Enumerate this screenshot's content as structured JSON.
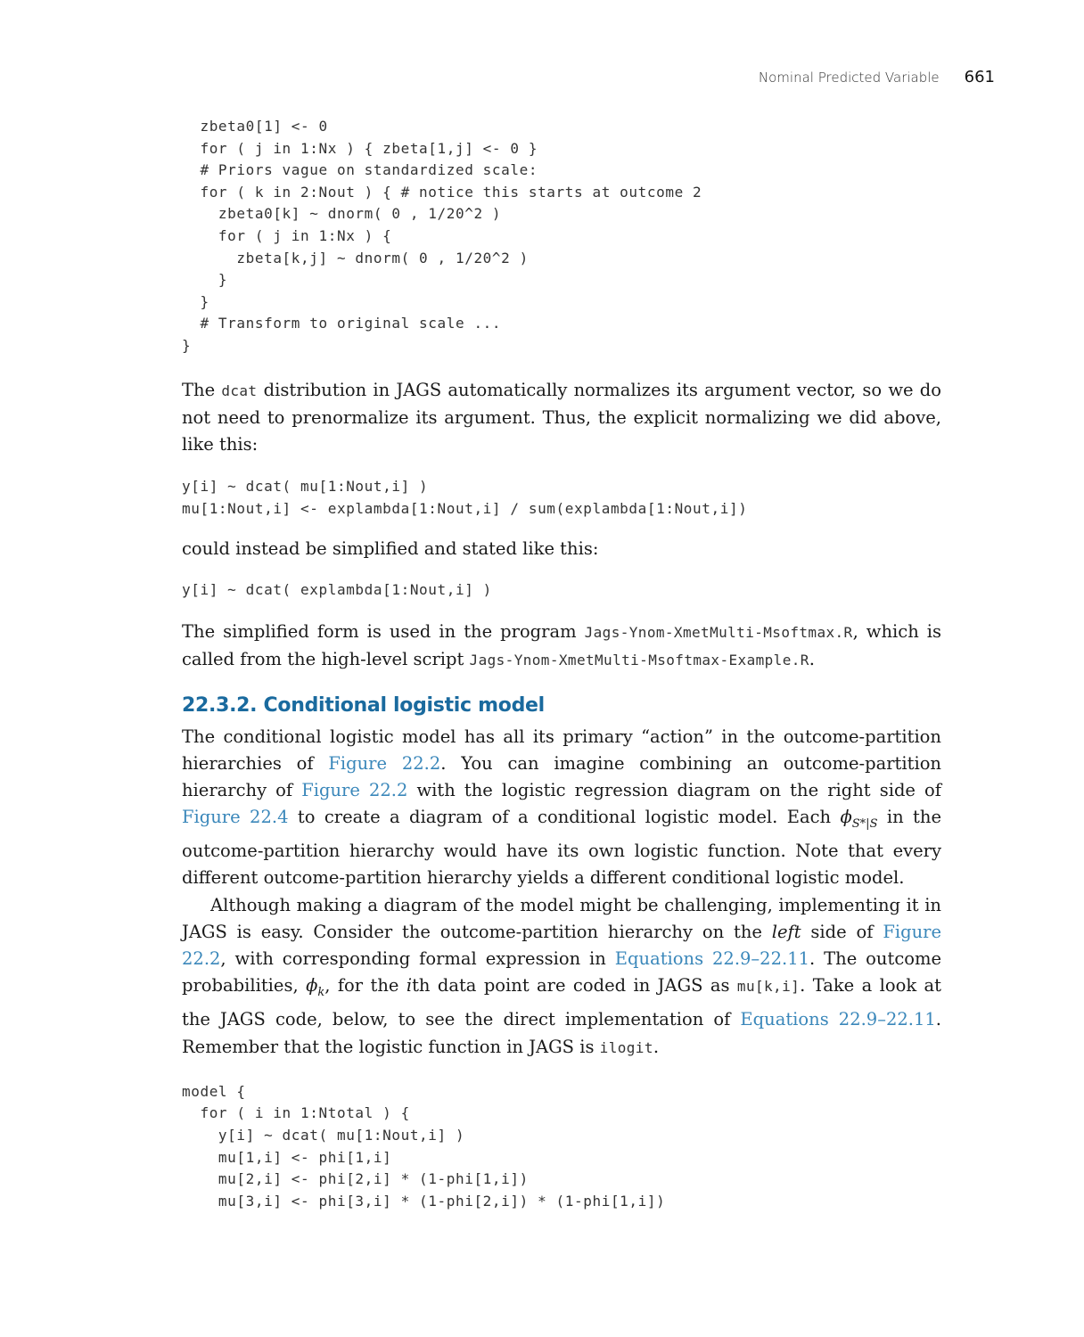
{
  "header": {
    "running_title": "Nominal Predicted Variable",
    "page_number": "661"
  },
  "code_block_1": [
    "  zbeta0[1] <- 0",
    "  for ( j in 1:Nx ) { zbeta[1,j] <- 0 }",
    "  # Priors vague on standardized scale:",
    "  for ( k in 2:Nout ) { # notice this starts at outcome 2",
    "    zbeta0[k] ~ dnorm( 0 , 1/20^2 )",
    "    for ( j in 1:Nx ) {",
    "      zbeta[k,j] ~ dnorm( 0 , 1/20^2 )",
    "    }",
    "  }",
    "  # Transform to original scale ...",
    "}"
  ],
  "para_1": {
    "t1": "The ",
    "code1": "dcat",
    "t2": " distribution in JAGS automatically normalizes its argument vector, so we do not need to prenormalize its argument. Thus, the explicit normalizing we did above, like this:"
  },
  "code_block_2": [
    "y[i] ~ dcat( mu[1:Nout,i] )",
    "mu[1:Nout,i] <- explambda[1:Nout,i] / sum(explambda[1:Nout,i])"
  ],
  "para_2": "could instead be simplified and stated like this:",
  "code_block_3": [
    "y[i] ~ dcat( explambda[1:Nout,i] )"
  ],
  "para_3": {
    "t1": "The simplified form is used in the program ",
    "code1": "Jags-Ynom-XmetMulti-Msoftmax.R",
    "t2": ", which is called from the high-level script ",
    "code2": "Jags-Ynom-XmetMulti-Msoftmax-Example.R",
    "t3": "."
  },
  "section": {
    "heading": "22.3.2.  Conditional logistic model"
  },
  "para_4": {
    "t1": "The conditional logistic model has all its primary “action” in the outcome-partition hierarchies of ",
    "link1": "Figure 22.2",
    "t2": ". You can imagine combining an outcome-partition hierarchy of ",
    "link2": "Figure 22.2",
    "t3": " with the logistic regression diagram on the right side of ",
    "link3": "Figure 22.4",
    "t4": " to create a diagram of a conditional logistic model. Each ",
    "math_phi": "ϕ",
    "math_sub": "S*|S",
    "t5": " in the outcome-partition hierarchy would have its own logistic function. Note that every different outcome-partition hierarchy yields a different conditional logistic model."
  },
  "para_5": {
    "t1": "Although making a diagram of the model might be challenging, implementing it in JAGS is easy. Consider the outcome-partition hierarchy on the ",
    "emph": "left",
    "t2": " side of ",
    "link1": "Figure 22.2",
    "t3": ", with corresponding formal expression in ",
    "link2": "Equations 22.9–22.11",
    "t4": ". The outcome probabilities, ",
    "math_phi": "ϕ",
    "math_sub": "k",
    "t5": ", for the ",
    "math_i": "i",
    "t6": "th data point are coded in JAGS as ",
    "code1": "mu[k,i]",
    "t7": ". Take a look at the JAGS code, below, to see the direct implementation of ",
    "link3": "Equations 22.9–22.11",
    "t8": ". Remember that the logistic function in JAGS is ",
    "code2": "ilogit",
    "t9": "."
  },
  "code_block_4": [
    "model {",
    "  for ( i in 1:Ntotal ) {",
    "    y[i] ~ dcat( mu[1:Nout,i] )",
    "    mu[1,i] <- phi[1,i]",
    "    mu[2,i] <- phi[2,i] * (1-phi[1,i])",
    "    mu[3,i] <- phi[3,i] * (1-phi[2,i]) * (1-phi[1,i])"
  ],
  "colors": {
    "heading": "#1a6a9e",
    "link": "#3a87ba",
    "text": "#1a1a1a"
  }
}
